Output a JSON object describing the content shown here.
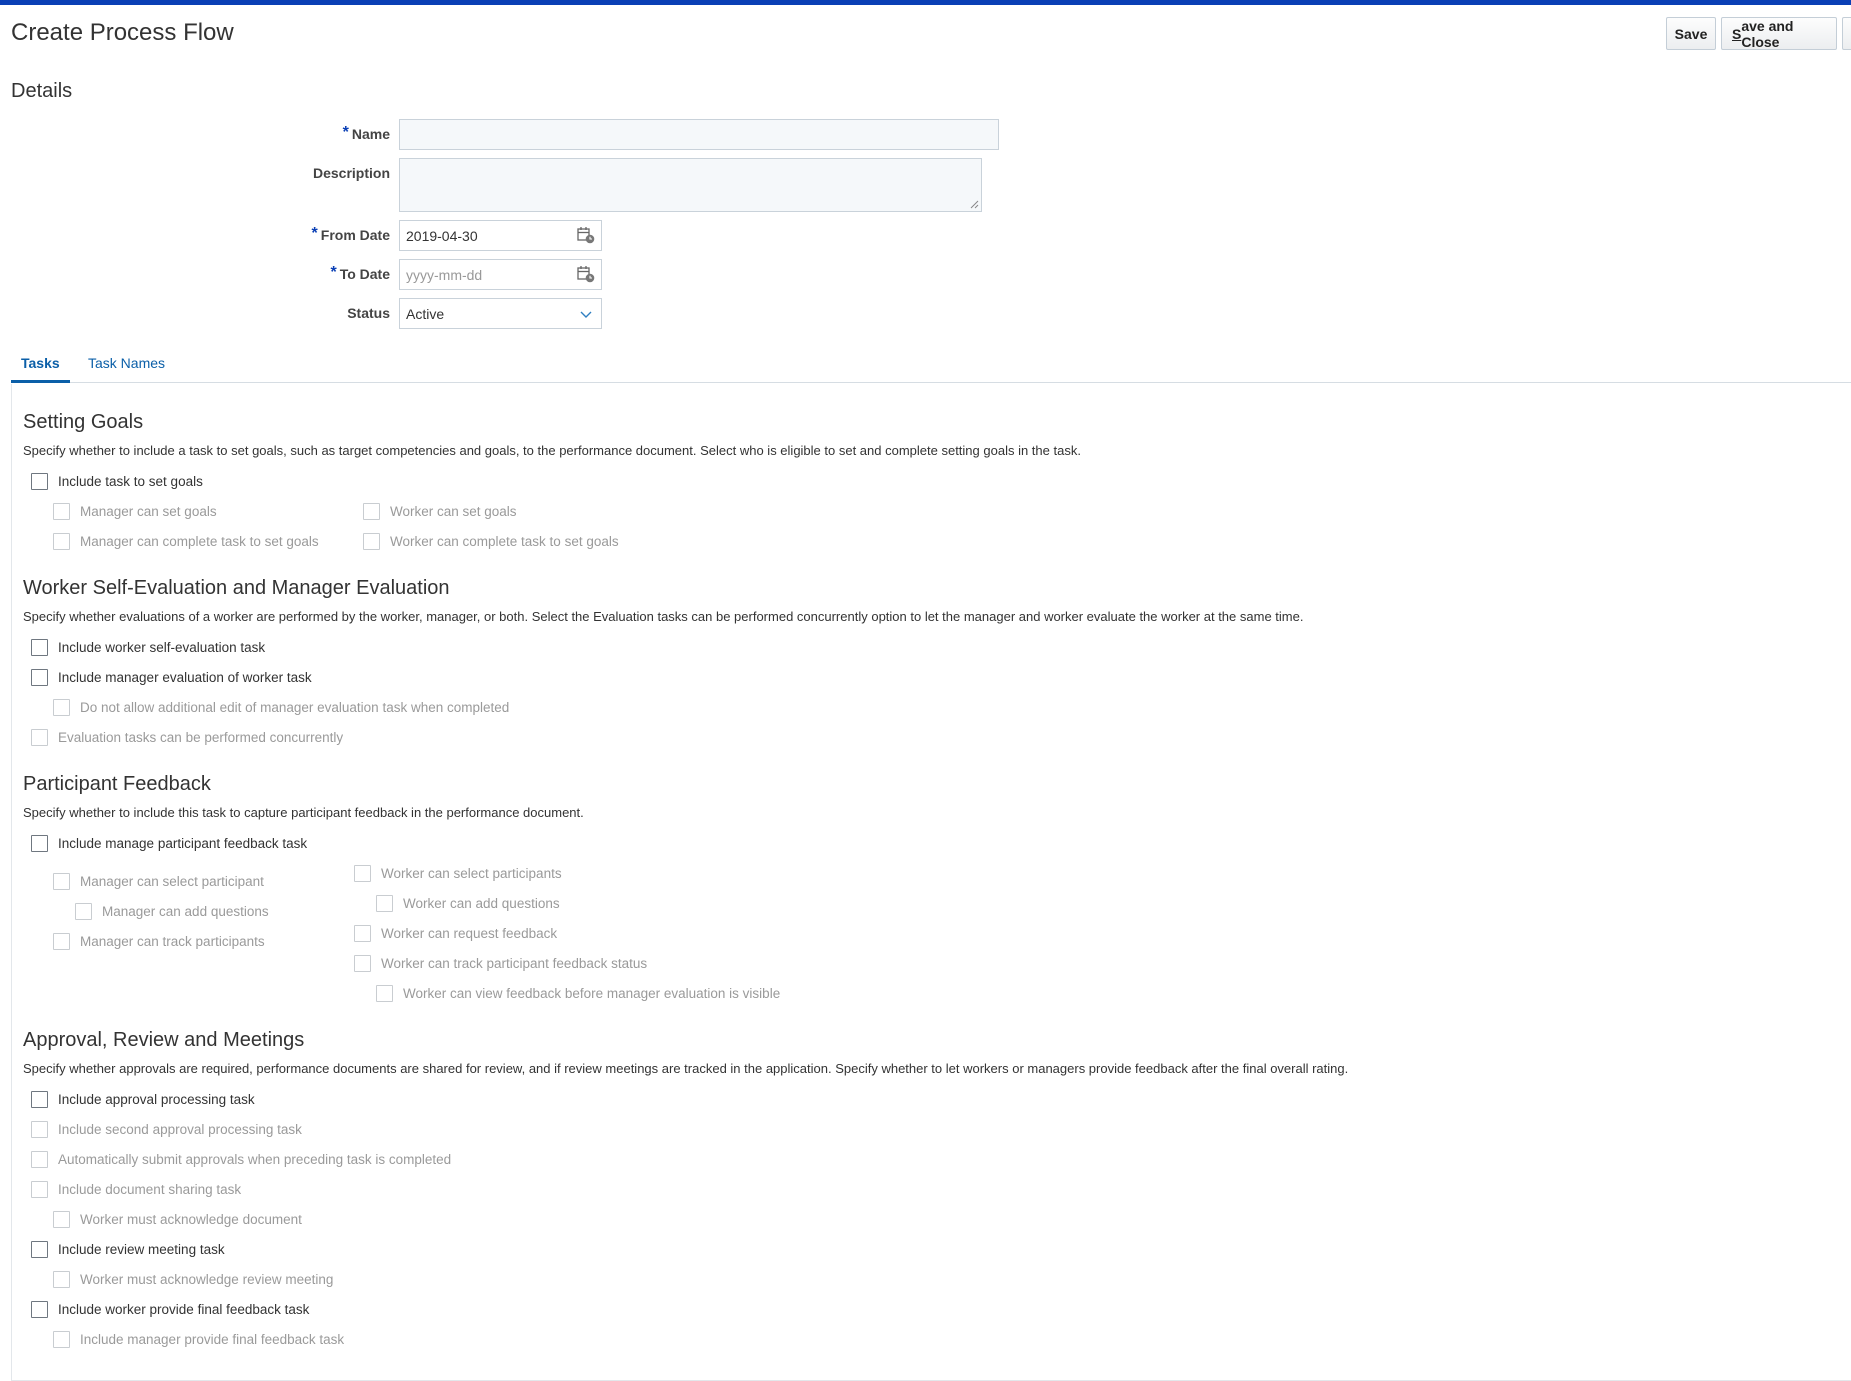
{
  "page": {
    "title": "Create Process Flow",
    "save_label": "Save",
    "save_close_label_first": "S",
    "save_close_label_rest": "ave and Close"
  },
  "details": {
    "title": "Details",
    "name_label": "Name",
    "name_value": "",
    "description_label": "Description",
    "description_value": "",
    "from_date_label": "From Date",
    "from_date_value": "2019-04-30",
    "to_date_label": "To Date",
    "to_date_placeholder": "yyyy-mm-dd",
    "status_label": "Status",
    "status_value": "Active",
    "required_marker": "*"
  },
  "tabs": [
    {
      "label": "Tasks",
      "active": true
    },
    {
      "label": "Task Names",
      "active": false
    }
  ],
  "sections": {
    "goals": {
      "title": "Setting Goals",
      "desc": "Specify whether to include a task to set goals, such as target competencies and goals, to the performance document. Select who is eligible to set and complete setting goals in the task.",
      "include": "Include task to set goals",
      "manager_set": "Manager can set goals",
      "worker_set": "Worker can set goals",
      "manager_complete": "Manager can complete task to set goals",
      "worker_complete": "Worker can complete task to set goals"
    },
    "evaluation": {
      "title": "Worker Self-Evaluation and Manager Evaluation",
      "desc": "Specify whether evaluations of a worker are performed by the worker, manager, or both. Select the Evaluation tasks can be performed concurrently option to let the manager and worker evaluate the worker at the same time.",
      "self_eval": "Include worker self-evaluation task",
      "manager_eval": "Include manager evaluation of worker task",
      "no_edit": "Do not allow additional edit of manager evaluation task when completed",
      "concurrent": "Evaluation tasks can be performed concurrently"
    },
    "feedback": {
      "title": "Participant Feedback",
      "desc": "Specify whether to include this task to capture participant feedback in the performance document.",
      "include": "Include manage participant feedback task",
      "mgr_select": "Manager can select participant",
      "mgr_questions": "Manager can add questions",
      "mgr_track": "Manager can track participants",
      "wkr_select": "Worker can select participants",
      "wkr_questions": "Worker can add questions",
      "wkr_request": "Worker can request feedback",
      "wkr_track": "Worker can track participant feedback status",
      "wkr_view": "Worker can view feedback before manager evaluation is visible"
    },
    "approval": {
      "title": "Approval, Review and Meetings",
      "desc": "Specify whether approvals are required, performance documents are shared for review, and if review meetings are tracked in the application. Specify whether to let workers or managers provide feedback after the final overall rating.",
      "approval": "Include approval processing task",
      "second_approval": "Include second approval processing task",
      "auto_submit": "Automatically submit approvals when preceding task is completed",
      "doc_sharing": "Include document sharing task",
      "ack_doc": "Worker must acknowledge document",
      "review_meeting": "Include review meeting task",
      "ack_meeting": "Worker must acknowledge review meeting",
      "worker_final": "Include worker provide final feedback task",
      "manager_final": "Include manager provide final feedback task"
    }
  },
  "colors": {
    "accent": "#0a3fb5",
    "link": "#0b5fa8",
    "disabled_text": "#9a9a9a"
  },
  "icons": [
    "calendar-icon",
    "chevron-down-icon",
    "resize-grip-icon"
  ]
}
